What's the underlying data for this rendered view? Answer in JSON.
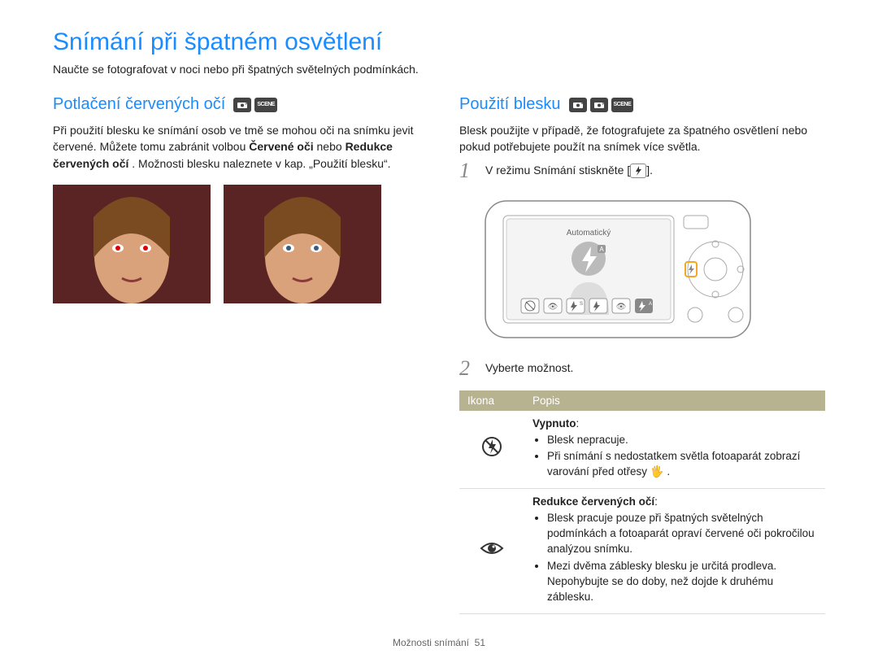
{
  "title": "Snímání při špatném osvětlení",
  "subtitle": "Naučte se fotografovat v noci nebo při špatných světelných podmínkách.",
  "left": {
    "heading": "Potlačení červených očí",
    "modes": [
      "📷p",
      "SCENE"
    ],
    "p1": "Při použití blesku ke snímání osob ve tmě se mohou oči na snímku jevit červené. Můžete tomu zabránit volbou ",
    "bold1": "Červené oči",
    "mid1": " nebo ",
    "bold2": "Redukce červených očí",
    "p2": ". Možnosti blesku naleznete v kap. „Použití blesku“."
  },
  "right": {
    "heading": "Použití blesku",
    "modes": [
      "📷a",
      "📷p",
      "SCENE"
    ],
    "intro": "Blesk použijte v případě, že fotografujete za špatného osvětlení nebo pokud potřebujete použít na snímek více světla.",
    "step1_a": "V režimu Snímání stiskněte [",
    "step1_b": "].",
    "step2": "Vyberte možnost.",
    "camera_label": "Automatický"
  },
  "table": {
    "col1": "Ikona",
    "col2": "Popis",
    "rows": [
      {
        "icon": "flash-off",
        "title": "Vypnuto",
        "colon": ":",
        "bullets": [
          "Blesk nepracuje.",
          "Při snímání s nedostatkem světla fotoaparát zobrazí varování před otřesy 🖐 ."
        ]
      },
      {
        "icon": "redeye",
        "title": "Redukce červených očí",
        "colon": ":",
        "bullets": [
          "Blesk pracuje pouze při špatných světelných podmínkách a fotoaparát opraví červené oči pokročilou analýzou snímku.",
          "Mezi dvěma záblesky blesku je určitá prodleva. Nepohybujte se do doby, než dojde k druhému záblesku."
        ]
      }
    ]
  },
  "footer_label": "Možnosti snímání",
  "footer_page": "51"
}
